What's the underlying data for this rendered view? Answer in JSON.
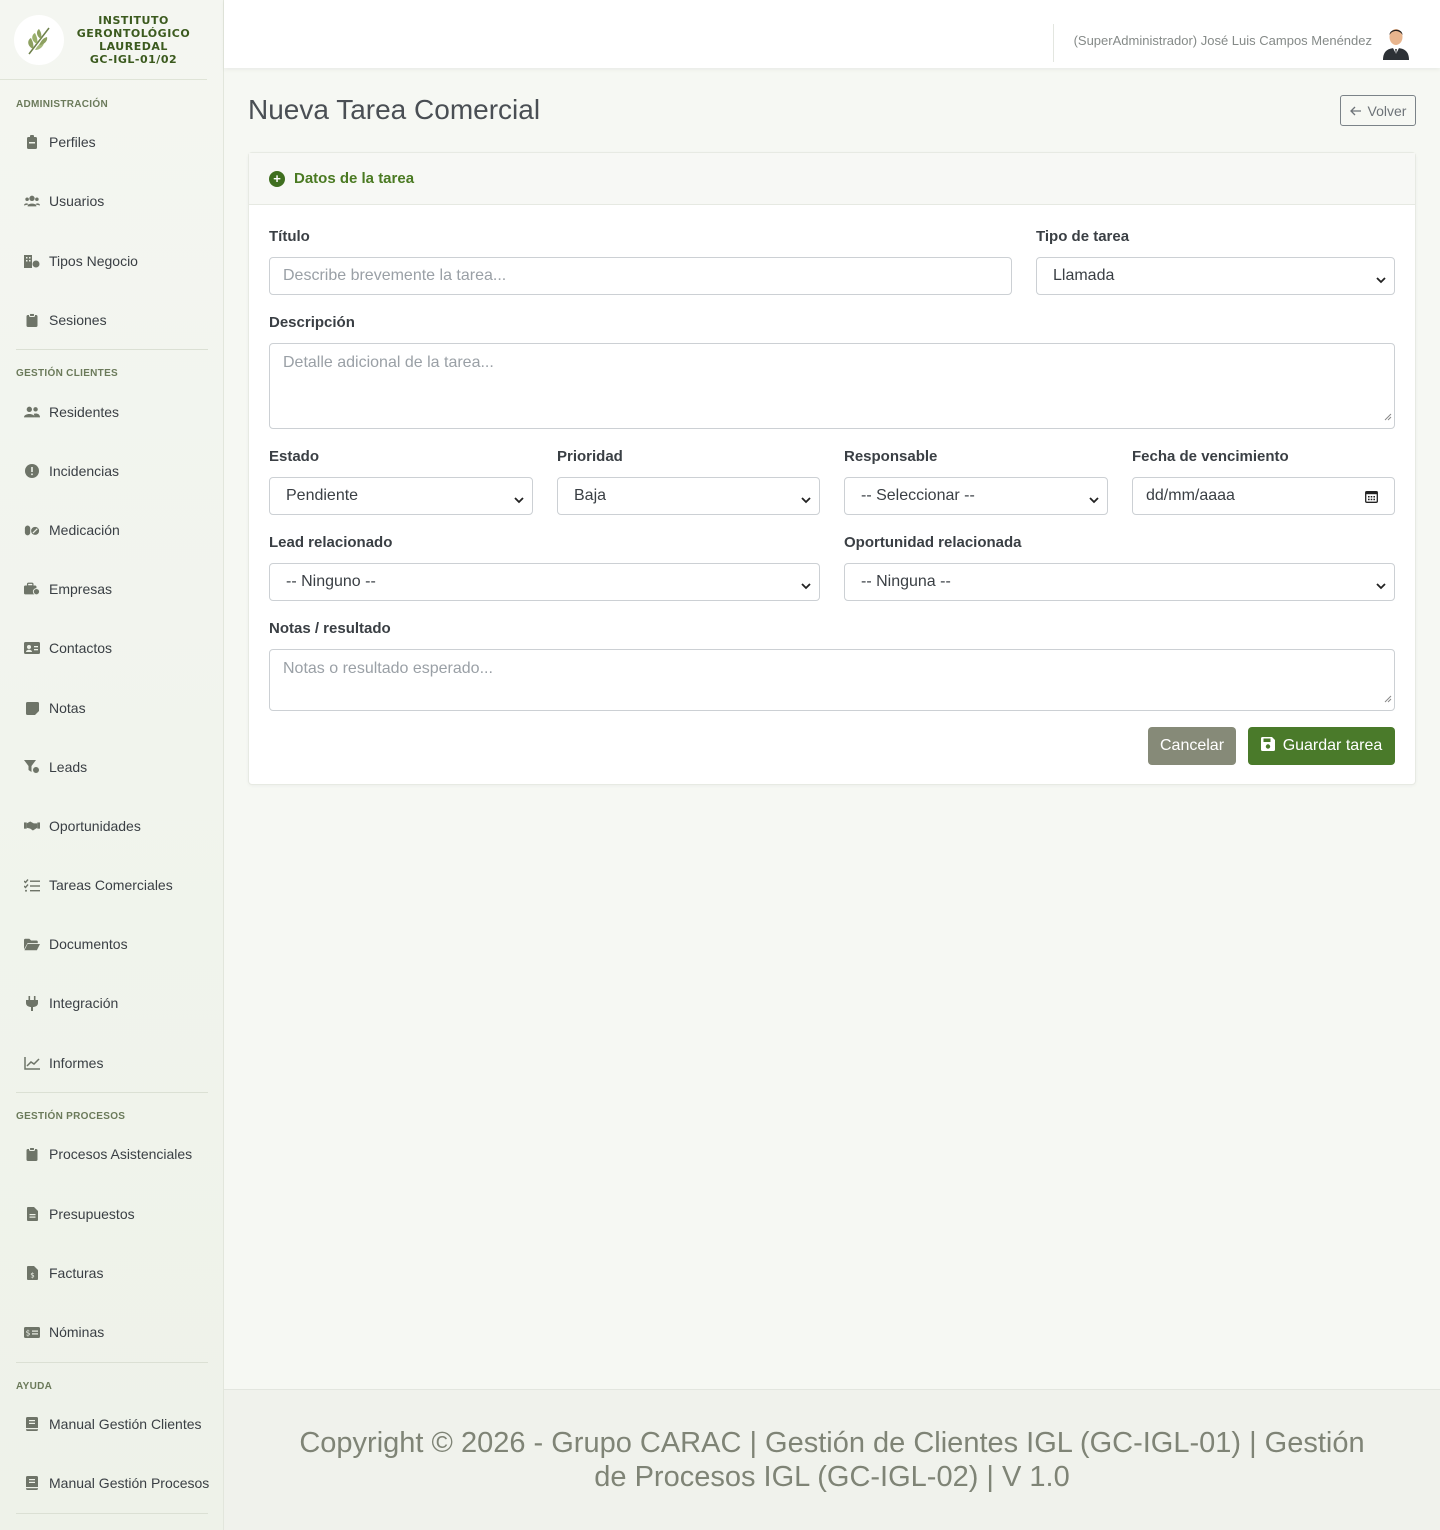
{
  "brand": {
    "line1": "INSTITUTO",
    "line2": "GERONTOLÓGICO",
    "line3": "LAUREDAL",
    "line4": "GC-IGL-01/02"
  },
  "sidebar": {
    "sections": [
      {
        "title": "ADMINISTRACIÓN",
        "items": [
          {
            "label": "Perfiles",
            "icon": "badge-icon"
          },
          {
            "label": "Usuarios",
            "icon": "users-icon"
          },
          {
            "label": "Tipos Negocio",
            "icon": "building-icon"
          },
          {
            "label": "Sesiones",
            "icon": "clipboard-icon"
          }
        ]
      },
      {
        "title": "GESTIÓN CLIENTES",
        "items": [
          {
            "label": "Residentes",
            "icon": "users-icon"
          },
          {
            "label": "Incidencias",
            "icon": "alert-icon"
          },
          {
            "label": "Medicación",
            "icon": "pills-icon"
          },
          {
            "label": "Empresas",
            "icon": "briefcase-icon"
          },
          {
            "label": "Contactos",
            "icon": "id-card-icon"
          },
          {
            "label": "Notas",
            "icon": "note-icon"
          },
          {
            "label": "Leads",
            "icon": "funnel-icon"
          },
          {
            "label": "Oportunidades",
            "icon": "handshake-icon"
          },
          {
            "label": "Tareas Comerciales",
            "icon": "list-check-icon"
          },
          {
            "label": "Documentos",
            "icon": "folder-icon"
          },
          {
            "label": "Integración",
            "icon": "plug-icon"
          },
          {
            "label": "Informes",
            "icon": "chart-line-icon"
          }
        ]
      },
      {
        "title": "GESTIÓN PROCESOS",
        "items": [
          {
            "label": "Procesos Asistenciales",
            "icon": "clipboard-icon"
          },
          {
            "label": "Presupuestos",
            "icon": "file-icon"
          },
          {
            "label": "Facturas",
            "icon": "invoice-icon"
          },
          {
            "label": "Nóminas",
            "icon": "money-icon"
          }
        ]
      },
      {
        "title": "AYUDA",
        "items": [
          {
            "label": "Manual Gestión Clientes",
            "icon": "book-icon"
          },
          {
            "label": "Manual Gestión Procesos",
            "icon": "book-icon"
          }
        ]
      }
    ]
  },
  "topbar": {
    "user": "(SuperAdministrador) José Luis Campos Menéndez"
  },
  "page": {
    "title": "Nueva Tarea Comercial",
    "back_label": "Volver"
  },
  "card": {
    "header": "Datos de la tarea"
  },
  "form": {
    "titulo": {
      "label": "Título",
      "placeholder": "Describe brevemente la tarea..."
    },
    "tipo": {
      "label": "Tipo de tarea",
      "value": "Llamada"
    },
    "descripcion": {
      "label": "Descripción",
      "placeholder": "Detalle adicional de la tarea..."
    },
    "estado": {
      "label": "Estado",
      "value": "Pendiente"
    },
    "prioridad": {
      "label": "Prioridad",
      "value": "Baja"
    },
    "responsable": {
      "label": "Responsable",
      "value": "-- Seleccionar --"
    },
    "fecha": {
      "label": "Fecha de vencimiento",
      "value": "dd/mm/aaaa"
    },
    "lead": {
      "label": "Lead relacionado",
      "value": "-- Ninguno --"
    },
    "oportunidad": {
      "label": "Oportunidad relacionada",
      "value": "-- Ninguna --"
    },
    "notas": {
      "label": "Notas / resultado",
      "placeholder": "Notas o resultado esperado..."
    }
  },
  "actions": {
    "cancel": "Cancelar",
    "save": "Guardar tarea"
  },
  "footer": {
    "text": "Copyright © 2026 - Grupo CARAC | Gestión de Clientes IGL (GC-IGL-01) | Gestión de Procesos IGL (GC-IGL-02) | V 1.0"
  },
  "colors": {
    "accent": "#4a7a2a",
    "sidebar_bg": "#eef2e9",
    "cancel": "#868a78"
  }
}
